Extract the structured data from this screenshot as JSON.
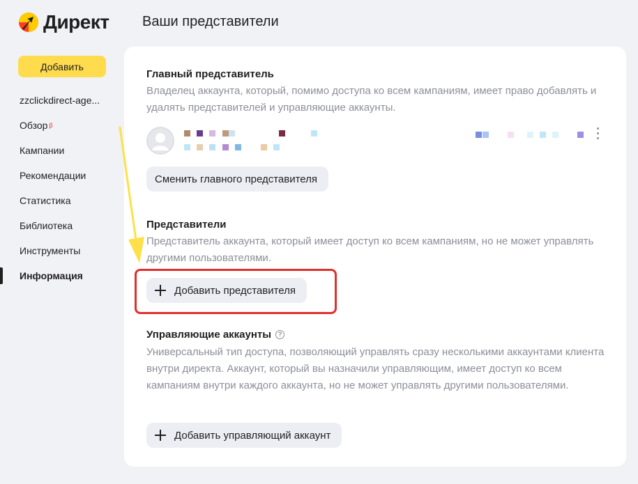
{
  "app": {
    "logo_text": "Директ"
  },
  "page": {
    "title": "Ваши представители"
  },
  "sidebar": {
    "add_label": "Добавить",
    "account": "zzclickdirect-age...",
    "items": [
      {
        "label": "Обзор",
        "badge": "β"
      },
      {
        "label": "Кампании"
      },
      {
        "label": "Рекомендации"
      },
      {
        "label": "Статистика"
      },
      {
        "label": "Библиотека"
      },
      {
        "label": "Инструменты"
      },
      {
        "label": "Информация",
        "active": true
      }
    ]
  },
  "main_rep": {
    "title": "Главный представитель",
    "desc": "Владелец аккаунта, который, помимо доступа ко всем кампаниям, имеет право добавлять и удалять представителей и управляющие аккаунты.",
    "change_label": "Сменить главного представителя"
  },
  "reps": {
    "title": "Представители",
    "desc": "Представитель аккаунта, который имеет доступ ко всем кампаниям, но не может управлять другими пользователями.",
    "add_label": "Добавить представителя"
  },
  "managers": {
    "title": "Управляющие аккаунты",
    "help": "?",
    "desc": "Универсальный тип доступа, позволяющий управлять сразу несколькими аккаунтами клиента внутри директа. Аккаунт, который вы назначили управляющим, имеет доступ ко всем кампаниям внутри каждого аккаунта, но не может управлять другими пользователями.",
    "add_label": "Добавить управляющий аккаунт"
  },
  "colors": {
    "accent": "#ffdb4d",
    "highlight": "#e0302b",
    "arrow": "#ffe04a",
    "muted": "#8c8f99"
  }
}
